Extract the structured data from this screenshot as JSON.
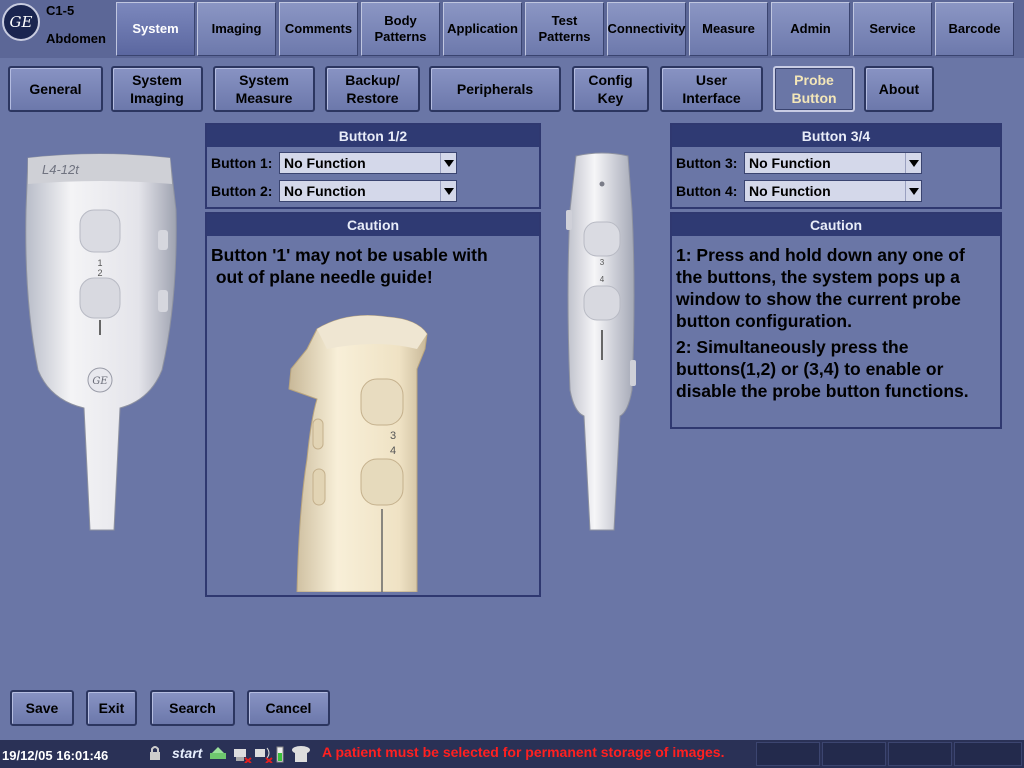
{
  "header": {
    "logo": "GE",
    "probe": "C1-5",
    "preset": "Abdomen",
    "tabs": [
      {
        "label": "System",
        "active": true
      },
      {
        "label": "Imaging"
      },
      {
        "label": "Comments"
      },
      {
        "label": "Body Patterns"
      },
      {
        "label": "Application"
      },
      {
        "label": "Test Patterns"
      },
      {
        "label": "Connectivity"
      },
      {
        "label": "Measure"
      },
      {
        "label": "Admin"
      },
      {
        "label": "Service"
      },
      {
        "label": "Barcode"
      }
    ]
  },
  "subtabs": [
    {
      "label": "General"
    },
    {
      "label": "System Imaging"
    },
    {
      "label": "System Measure"
    },
    {
      "label": "Backup/ Restore"
    },
    {
      "label": "Peripherals"
    },
    {
      "label": "Config Key"
    },
    {
      "label": "User Interface"
    },
    {
      "label": "Probe Button",
      "active": true
    },
    {
      "label": "About"
    }
  ],
  "left_probe": {
    "model_label": "L4-12t",
    "button_numbers": [
      "1",
      "2"
    ],
    "logo": "GE"
  },
  "center_image": {
    "button_numbers": [
      "3",
      "4"
    ]
  },
  "right_probe": {
    "button_numbers": [
      "3",
      "4"
    ]
  },
  "panel12": {
    "title": "Button 1/2",
    "rows": [
      {
        "label": "Button 1:",
        "value": "No Function"
      },
      {
        "label": "Button 2:",
        "value": "No Function"
      }
    ]
  },
  "panel34": {
    "title": "Button 3/4",
    "rows": [
      {
        "label": "Button 3:",
        "value": "No Function"
      },
      {
        "label": "Button 4:",
        "value": "No Function"
      }
    ]
  },
  "caution_left": {
    "title": "Caution",
    "line1": "Button '1' may not be usable with",
    "line2": " out of plane needle guide!"
  },
  "caution_right": {
    "title": "Caution",
    "p1": "1: Press and hold down any one of the buttons, the system pops up a window to show the current probe button configuration.",
    "p2": "2: Simultaneously press the buttons(1,2) or (3,4) to enable or disable the probe button functions."
  },
  "buttons": {
    "save": "Save",
    "exit": "Exit",
    "search": "Search",
    "cancel": "Cancel"
  },
  "status": {
    "datetime": "19/12/05 16:01:46",
    "start": "start",
    "message": "A patient must be selected for permanent storage of images.",
    "ge_logo": "GE",
    "icons": [
      "lock-icon",
      "network-icon",
      "printer-icon",
      "wireless-icon",
      "battery-icon",
      "phone-icon"
    ]
  },
  "colors": {
    "background": "#6a76a6",
    "panel_title": "#2f3a73",
    "active_subtab_text": "#f3e6b8",
    "status_message": "#ff2020"
  }
}
